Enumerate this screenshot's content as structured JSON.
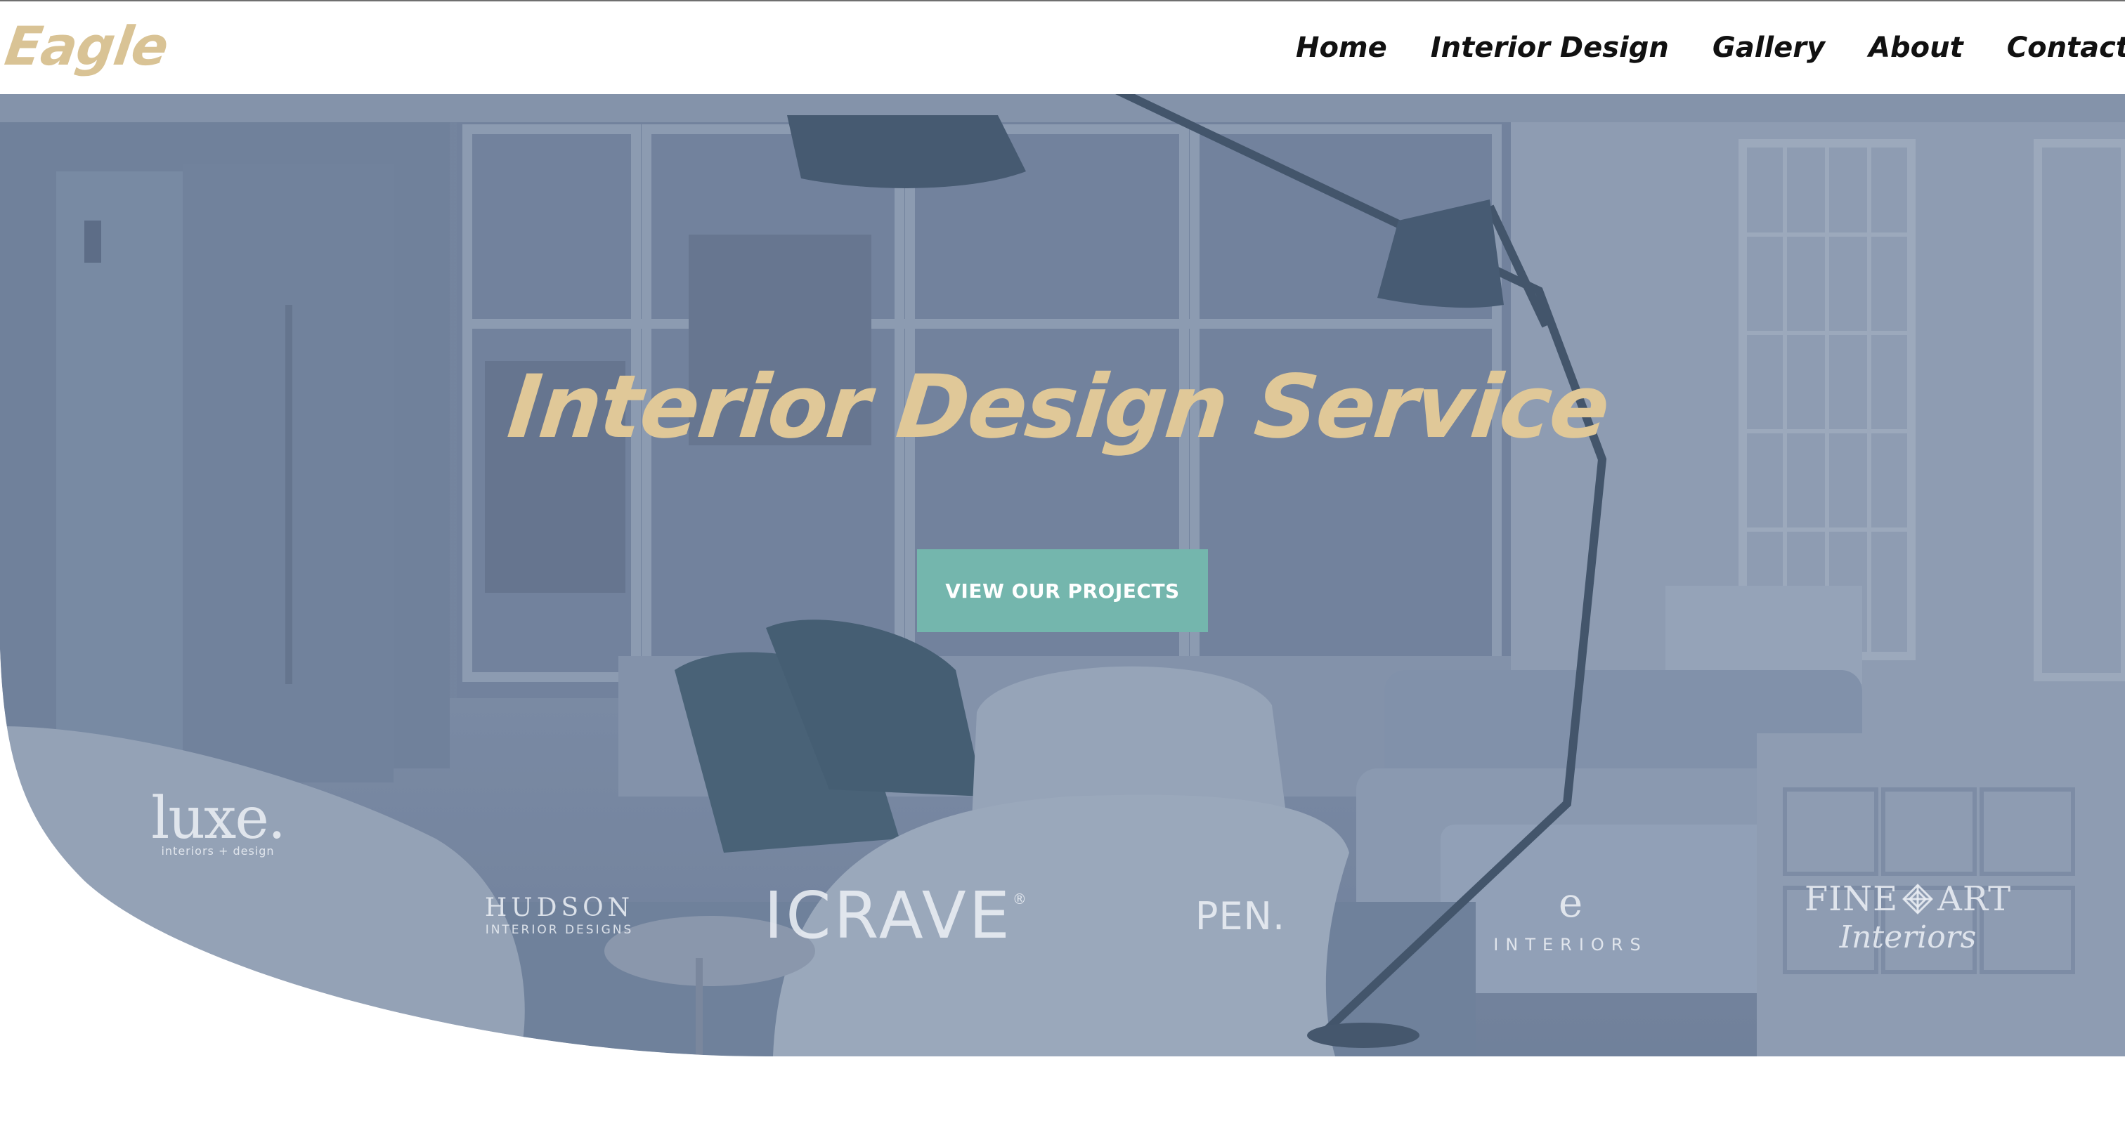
{
  "brand": {
    "logo": "Eagle",
    "accent_color": "#d9c395"
  },
  "nav": {
    "items": [
      {
        "label": "Home"
      },
      {
        "label": "Interior Design"
      },
      {
        "label": "Gallery"
      },
      {
        "label": "About"
      },
      {
        "label": "Contact"
      }
    ]
  },
  "hero": {
    "title": "Interior Design Service",
    "cta_label": "VIEW OUR PROJECTS",
    "cta_color": "#74b6ad",
    "overlay_color": "#5c6f8c"
  },
  "logos": {
    "luxe_main": "luxe.",
    "luxe_sub": "interiors + design",
    "hudson_main": "HUDSON",
    "hudson_sub": "INTERIOR DESIGNS",
    "icrave_main": "ICRAVE",
    "icrave_reg": "®",
    "pen_main": "PEN.",
    "e_interiors_mark": "e",
    "e_interiors_sub": "INTERIORS",
    "fineart_left": "FINE",
    "fineart_right": "ART",
    "fineart_sub": "Interiors"
  }
}
